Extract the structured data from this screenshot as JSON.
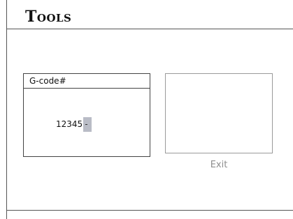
{
  "header": {
    "title": "Tools"
  },
  "gcode_panel": {
    "label": "G-code#",
    "value": "12345"
  },
  "exit": {
    "label": "Exit"
  },
  "colors": {
    "background": "#ffffff",
    "border": "#555555",
    "cursor_highlight": "#b9bcc6",
    "exit_text": "#8e8e8e"
  }
}
